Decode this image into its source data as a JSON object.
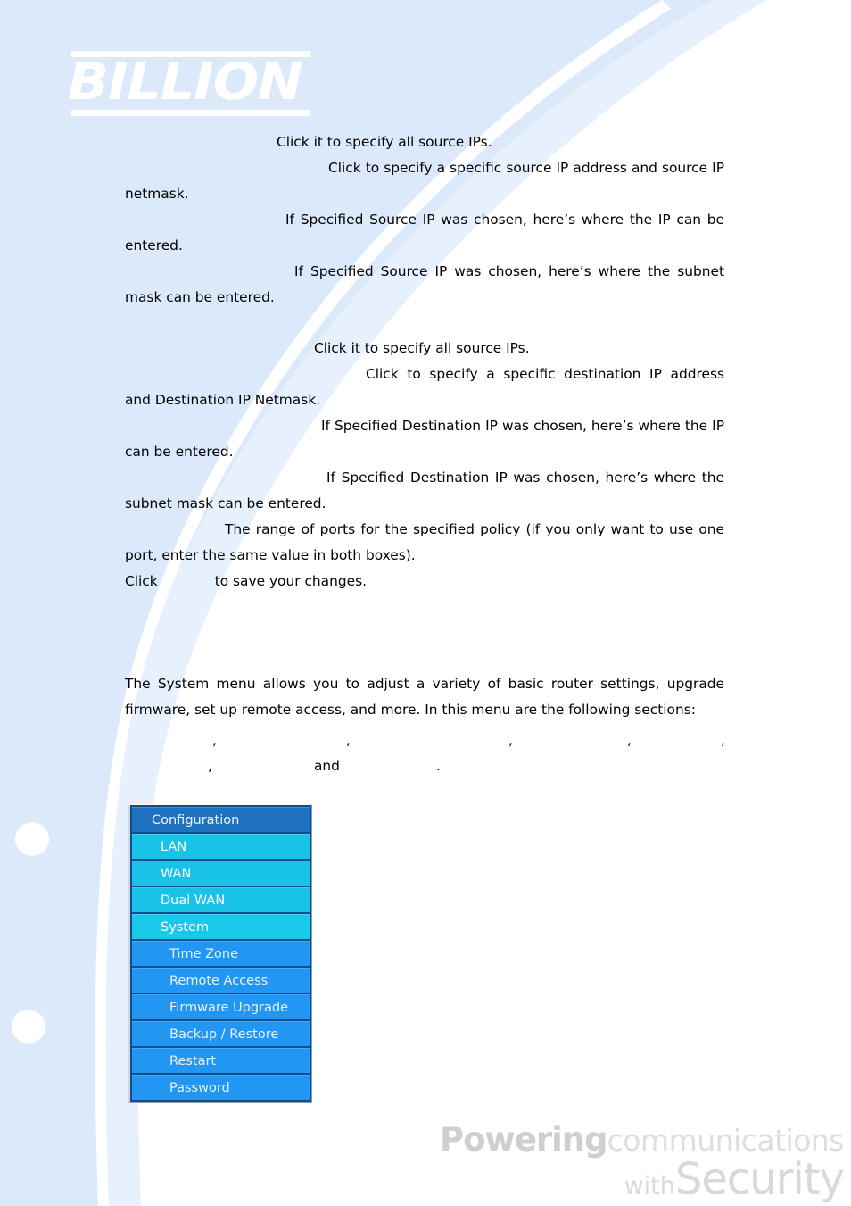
{
  "brand": {
    "logo_text": "BILLION",
    "tagline_powering": "Powering",
    "tagline_communications": "communications",
    "tagline_with": "with",
    "tagline_security": "Security"
  },
  "colors": {
    "page_background": "#ffffff",
    "decor_blue": "#dce9fb",
    "decor_blue_soft": "#e7f0fd",
    "menu_header": "#1f72c0",
    "menu_level1": "#19c3e8",
    "menu_level2": "#2196f3",
    "menu_frame": "#0d4f8b",
    "tagline_gray": "#d6d6d6",
    "text": "#000000"
  },
  "body": {
    "p1": "Click it to specify all source IPs.",
    "p2": "Click to specify a specific source IP address and source IP netmask.",
    "p3": "If Specified Source IP was chosen, here’s where the IP can be entered.",
    "p4": "If Specified Source IP was chosen, here’s where the subnet mask can be entered.",
    "p5": "Click it to specify all source IPs.",
    "p6": "Click to specify a specific destination IP address and Destination IP Netmask.",
    "p7": "If Specified Destination IP was chosen, here’s where the IP can be entered.",
    "p8": "If Specified Destination IP was chosen, here’s where the subnet mask can be entered.",
    "p9": "The range of ports for the specified policy (if you only want to use one port, enter the same value in both boxes).",
    "p10_prefix": "Click",
    "p10_suffix": "to save your changes.",
    "p11": "The System menu allows you to adjust a variety of basic router settings, upgrade firmware, set up remote access, and more. In this menu are the following sections:",
    "sections_sep1": ",",
    "sections_sep2": ",",
    "sections_sep3": ",",
    "sections_sep4": ",",
    "sections_sep5": ",",
    "sections_sep6": ",",
    "sections_and": "and",
    "sections_end": "."
  },
  "menu": {
    "header": {
      "label": "Configuration"
    },
    "items": [
      {
        "label": "LAN",
        "level": 1,
        "active": false
      },
      {
        "label": "WAN",
        "level": 1,
        "active": false
      },
      {
        "label": "Dual WAN",
        "level": 1,
        "active": false
      },
      {
        "label": "System",
        "level": 1,
        "active": true
      },
      {
        "label": "Time Zone",
        "level": 2,
        "active": false
      },
      {
        "label": "Remote Access",
        "level": 2,
        "active": false
      },
      {
        "label": "Firmware Upgrade",
        "level": 2,
        "active": false
      },
      {
        "label": "Backup / Restore",
        "level": 2,
        "active": false
      },
      {
        "label": "Restart",
        "level": 2,
        "active": false
      },
      {
        "label": "Password",
        "level": 2,
        "active": false
      }
    ]
  }
}
